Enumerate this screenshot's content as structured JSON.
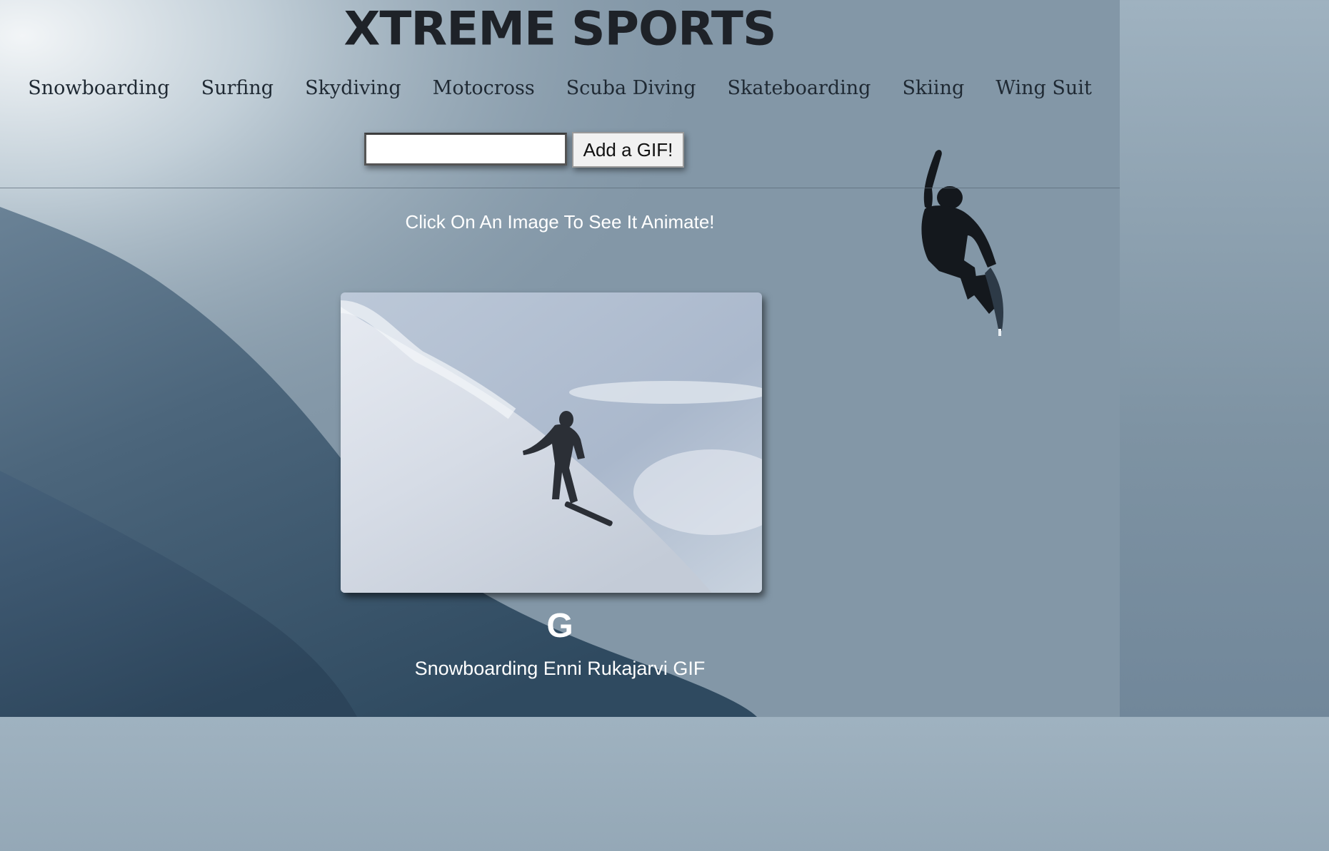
{
  "site": {
    "title": "XTREME SPORTS"
  },
  "nav": {
    "items": [
      {
        "label": "Snowboarding"
      },
      {
        "label": "Surfing"
      },
      {
        "label": "Skydiving"
      },
      {
        "label": "Motocross"
      },
      {
        "label": "Scuba Diving"
      },
      {
        "label": "Skateboarding"
      },
      {
        "label": "Skiing"
      },
      {
        "label": "Wing Suit"
      }
    ]
  },
  "form": {
    "input_value": "",
    "input_placeholder": "",
    "add_button_label": "Add a GIF!"
  },
  "results": {
    "instruction": "Click On An Image To See It Animate!",
    "gifs": [
      {
        "rating": "G",
        "caption": "Snowboarding Enni Rukajarvi GIF",
        "image_alt": "snowboarder on steep snowy slope"
      }
    ]
  },
  "colors": {
    "title": "#1e2228",
    "nav_text": "#1f2933",
    "light_text": "#ffffff",
    "background_sky": "#8ea2b1",
    "slope": "#3f5a70"
  },
  "icons": {
    "background": "mountain-slope-image",
    "rider": "snowboarder-silhouette-image"
  }
}
